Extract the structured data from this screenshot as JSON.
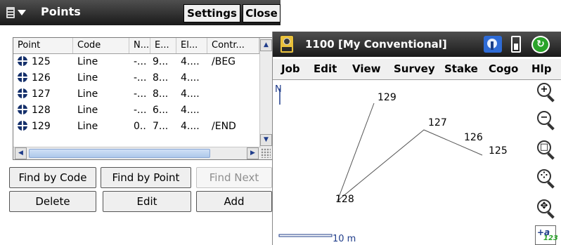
{
  "points_window": {
    "title": "Points",
    "menu_icon": "document-menu-icon",
    "settings_label": "Settings",
    "close_label": "Close",
    "columns": [
      "Point",
      "Code",
      "N...",
      "E...",
      "El...",
      "Contr..."
    ],
    "rows": [
      {
        "point": "125",
        "code": "Line",
        "n": "-...",
        "e": "9...",
        "el": "4....",
        "ctrl": "/BEG"
      },
      {
        "point": "126",
        "code": "Line",
        "n": "-...",
        "e": "8...",
        "el": "4....",
        "ctrl": ""
      },
      {
        "point": "127",
        "code": "Line",
        "n": "-...",
        "e": "8...",
        "el": "4....",
        "ctrl": ""
      },
      {
        "point": "128",
        "code": "Line",
        "n": "-...",
        "e": "6...",
        "el": "4....",
        "ctrl": ""
      },
      {
        "point": "129",
        "code": "Line",
        "n": "0..",
        "e": "7...",
        "el": "4....",
        "ctrl": "/END"
      }
    ],
    "buttons": {
      "find_by_code": "Find by Code",
      "find_by_point": "Find by Point",
      "find_next": "Find Next",
      "delete": "Delete",
      "edit": "Edit",
      "add": "Add"
    }
  },
  "job_window": {
    "title": "1100 [My Conventional]",
    "menu": [
      "Job",
      "Edit",
      "View",
      "Survey",
      "Stake",
      "Cogo",
      "Hlp"
    ],
    "map": {
      "north_label": "N",
      "points": [
        "129",
        "127",
        "126",
        "125",
        "128"
      ],
      "scale_label": "10 m"
    },
    "toolbar": [
      "zoom-in-icon",
      "zoom-out-icon",
      "zoom-extents-icon",
      "zoom-window-icon",
      "pan-icon",
      "point-labels-icon"
    ],
    "label_tool_text": {
      "a": "+a",
      "num": "123"
    }
  },
  "colors": {
    "titlebar": "#2b2b2b",
    "accent": "#1f3c8a",
    "scroll_thumb": "#aec8ea",
    "sync": "#2aa32a"
  }
}
